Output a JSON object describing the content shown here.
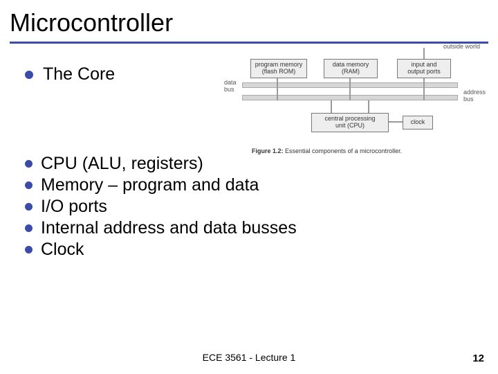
{
  "title": "Microcontroller",
  "section_heading": "The Core",
  "core_items": [
    "CPU (ALU, registers)",
    "Memory – program and data",
    "I/O ports",
    "Internal address and data busses",
    "Clock"
  ],
  "diagram": {
    "outside_world": "outside world",
    "program_memory": {
      "line1": "program memory",
      "line2": "(flash ROM)"
    },
    "data_memory": {
      "line1": "data memory",
      "line2": "(RAM)"
    },
    "io_ports": {
      "line1": "input and",
      "line2": "output ports"
    },
    "cpu": {
      "line1": "central processing",
      "line2": "unit (CPU)"
    },
    "clock": "clock",
    "data_bus": "data\nbus",
    "address_bus": "address\nbus",
    "caption_label": "Figure 1.2:",
    "caption_text": "Essential components of a microcontroller."
  },
  "footer": "ECE 3561 - Lecture 1",
  "page_number": "12"
}
